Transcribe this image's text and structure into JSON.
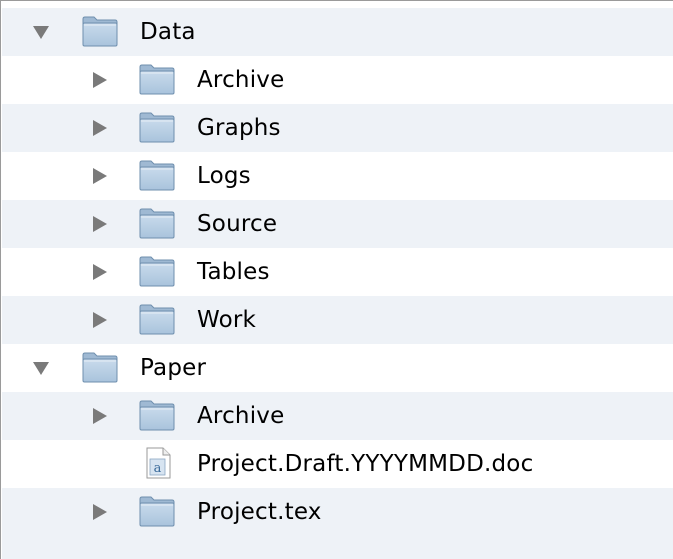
{
  "colors": {
    "stripe": "#eef2f7",
    "folder": "#a9c3dc",
    "disclosure": "#7a7a7a"
  },
  "tree": [
    {
      "label": "Data",
      "level": 0,
      "kind": "folder",
      "expanded": true,
      "icon": "folder-icon",
      "disclosure": "triangle-down-icon"
    },
    {
      "label": "Archive",
      "level": 1,
      "kind": "folder",
      "expanded": false,
      "icon": "folder-icon",
      "disclosure": "triangle-right-icon"
    },
    {
      "label": "Graphs",
      "level": 1,
      "kind": "folder",
      "expanded": false,
      "icon": "folder-icon",
      "disclosure": "triangle-right-icon"
    },
    {
      "label": "Logs",
      "level": 1,
      "kind": "folder",
      "expanded": false,
      "icon": "folder-icon",
      "disclosure": "triangle-right-icon"
    },
    {
      "label": "Source",
      "level": 1,
      "kind": "folder",
      "expanded": false,
      "icon": "folder-icon",
      "disclosure": "triangle-right-icon"
    },
    {
      "label": "Tables",
      "level": 1,
      "kind": "folder",
      "expanded": false,
      "icon": "folder-icon",
      "disclosure": "triangle-right-icon"
    },
    {
      "label": "Work",
      "level": 1,
      "kind": "folder",
      "expanded": false,
      "icon": "folder-icon",
      "disclosure": "triangle-right-icon"
    },
    {
      "label": "Paper",
      "level": 0,
      "kind": "folder",
      "expanded": true,
      "icon": "folder-icon",
      "disclosure": "triangle-down-icon"
    },
    {
      "label": "Archive",
      "level": 1,
      "kind": "folder",
      "expanded": false,
      "icon": "folder-icon",
      "disclosure": "triangle-right-icon"
    },
    {
      "label": "Project.Draft.YYYYMMDD.doc",
      "level": 1,
      "kind": "file",
      "expanded": false,
      "icon": "document-icon",
      "disclosure": ""
    },
    {
      "label": "Project.tex",
      "level": 1,
      "kind": "folder",
      "expanded": false,
      "icon": "folder-icon",
      "disclosure": "triangle-right-icon"
    }
  ]
}
